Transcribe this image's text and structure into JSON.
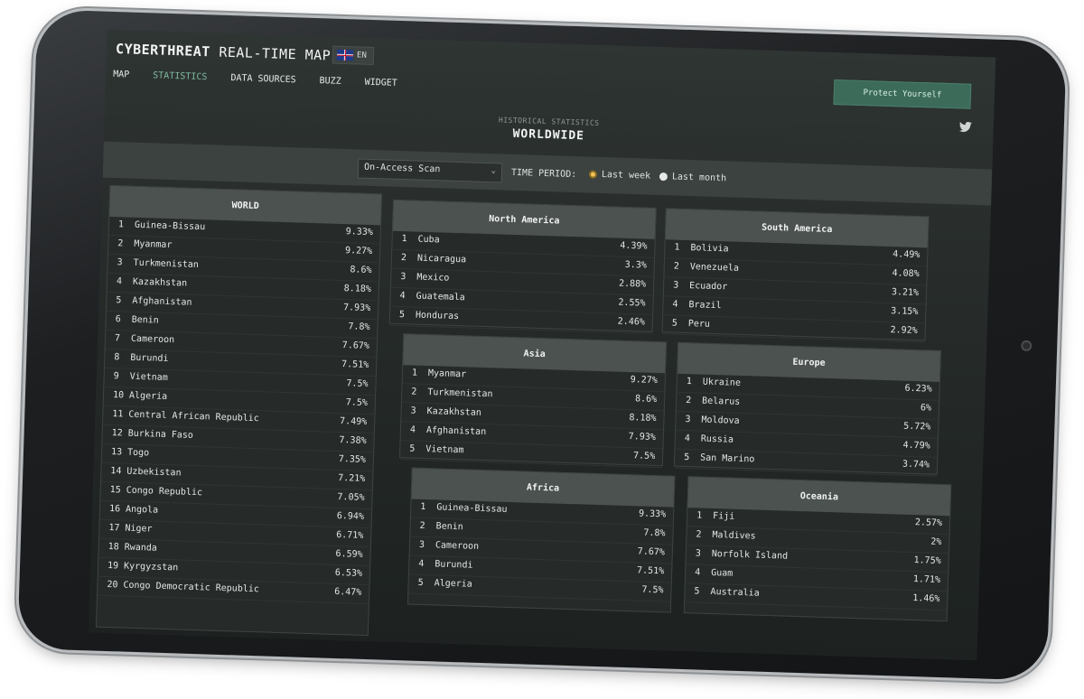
{
  "header": {
    "brand_bold": "CYBERTHREAT",
    "brand_rest": "REAL-TIME MAP",
    "lang": "EN",
    "protect_label": "Protect Yourself",
    "subtitle": "HISTORICAL STATISTICS",
    "title": "WORLDWIDE"
  },
  "nav": [
    "MAP",
    "STATISTICS",
    "DATA SOURCES",
    "BUZZ",
    "WIDGET"
  ],
  "filters": {
    "scan_type": "On-Access Scan",
    "period_label": "TIME PERIOD:",
    "options": [
      "Last week",
      "Last month"
    ],
    "selected": "Last week"
  },
  "panels": {
    "world": {
      "title": "WORLD",
      "rows": [
        [
          "1",
          "Guinea-Bissau",
          "9.33%"
        ],
        [
          "2",
          "Myanmar",
          "9.27%"
        ],
        [
          "3",
          "Turkmenistan",
          "8.6%"
        ],
        [
          "4",
          "Kazakhstan",
          "8.18%"
        ],
        [
          "5",
          "Afghanistan",
          "7.93%"
        ],
        [
          "6",
          "Benin",
          "7.8%"
        ],
        [
          "7",
          "Cameroon",
          "7.67%"
        ],
        [
          "8",
          "Burundi",
          "7.51%"
        ],
        [
          "9",
          "Vietnam",
          "7.5%"
        ],
        [
          "10",
          "Algeria",
          "7.5%"
        ],
        [
          "11",
          "Central African Republic",
          "7.49%"
        ],
        [
          "12",
          "Burkina Faso",
          "7.38%"
        ],
        [
          "13",
          "Togo",
          "7.35%"
        ],
        [
          "14",
          "Uzbekistan",
          "7.21%"
        ],
        [
          "15",
          "Congo Republic",
          "7.05%"
        ],
        [
          "16",
          "Angola",
          "6.94%"
        ],
        [
          "17",
          "Niger",
          "6.71%"
        ],
        [
          "18",
          "Rwanda",
          "6.59%"
        ],
        [
          "19",
          "Kyrgyzstan",
          "6.53%"
        ],
        [
          "20",
          "Congo Democratic Republic",
          "6.47%"
        ]
      ]
    },
    "north_america": {
      "title": "North America",
      "rows": [
        [
          "1",
          "Cuba",
          "4.39%"
        ],
        [
          "2",
          "Nicaragua",
          "3.3%"
        ],
        [
          "3",
          "Mexico",
          "2.88%"
        ],
        [
          "4",
          "Guatemala",
          "2.55%"
        ],
        [
          "5",
          "Honduras",
          "2.46%"
        ]
      ]
    },
    "south_america": {
      "title": "South America",
      "rows": [
        [
          "1",
          "Bolivia",
          "4.49%"
        ],
        [
          "2",
          "Venezuela",
          "4.08%"
        ],
        [
          "3",
          "Ecuador",
          "3.21%"
        ],
        [
          "4",
          "Brazil",
          "3.15%"
        ],
        [
          "5",
          "Peru",
          "2.92%"
        ]
      ]
    },
    "asia": {
      "title": "Asia",
      "rows": [
        [
          "1",
          "Myanmar",
          "9.27%"
        ],
        [
          "2",
          "Turkmenistan",
          "8.6%"
        ],
        [
          "3",
          "Kazakhstan",
          "8.18%"
        ],
        [
          "4",
          "Afghanistan",
          "7.93%"
        ],
        [
          "5",
          "Vietnam",
          "7.5%"
        ]
      ]
    },
    "europe": {
      "title": "Europe",
      "rows": [
        [
          "1",
          "Ukraine",
          "6.23%"
        ],
        [
          "2",
          "Belarus",
          "6%"
        ],
        [
          "3",
          "Moldova",
          "5.72%"
        ],
        [
          "4",
          "Russia",
          "4.79%"
        ],
        [
          "5",
          "San Marino",
          "3.74%"
        ]
      ]
    },
    "africa": {
      "title": "Africa",
      "rows": [
        [
          "1",
          "Guinea-Bissau",
          "9.33%"
        ],
        [
          "2",
          "Benin",
          "7.8%"
        ],
        [
          "3",
          "Cameroon",
          "7.67%"
        ],
        [
          "4",
          "Burundi",
          "7.51%"
        ],
        [
          "5",
          "Algeria",
          "7.5%"
        ]
      ]
    },
    "oceania": {
      "title": "Oceania",
      "rows": [
        [
          "1",
          "Fiji",
          "2.57%"
        ],
        [
          "2",
          "Maldives",
          "2%"
        ],
        [
          "3",
          "Norfolk Island",
          "1.75%"
        ],
        [
          "4",
          "Guam",
          "1.71%"
        ],
        [
          "5",
          "Australia",
          "1.46%"
        ]
      ]
    }
  },
  "icons": {
    "twitter": "twitter-icon",
    "flag": "uk-flag-icon",
    "chevron": "chevron-down-icon"
  },
  "colors": {
    "accent": "#7fb9a1",
    "protect_bg": "#3c6b5a",
    "radio_on": "#f2c25a"
  }
}
